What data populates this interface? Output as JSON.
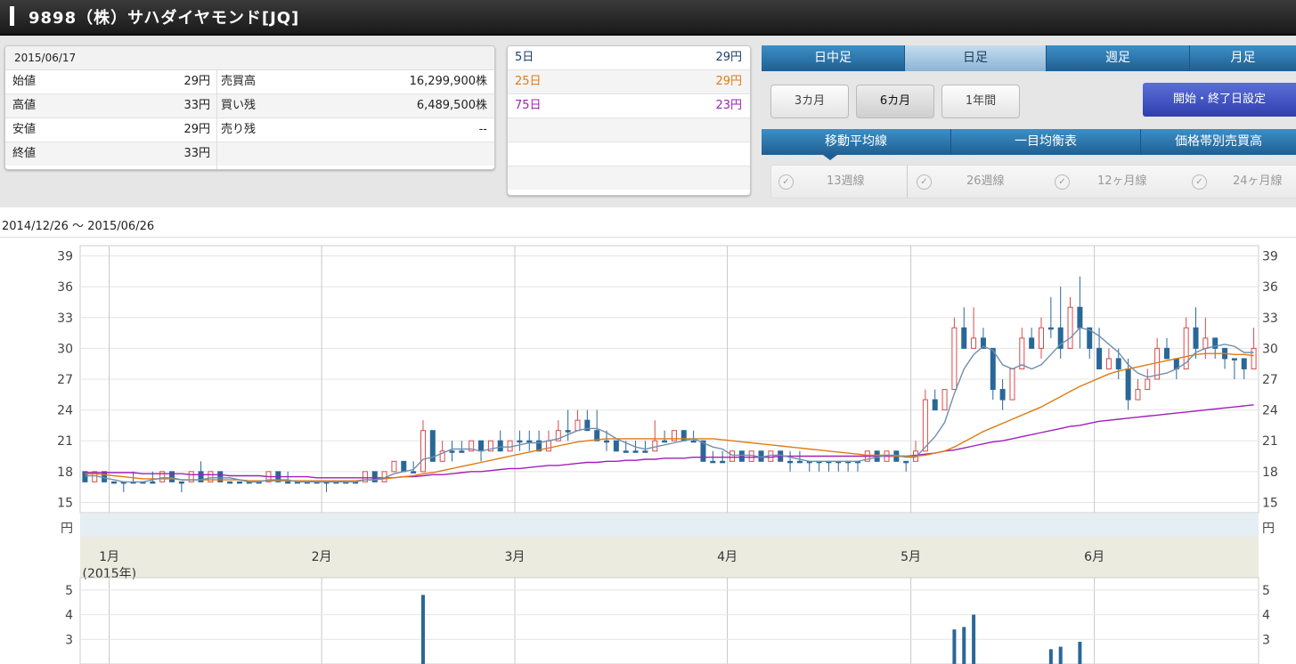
{
  "title": "9898（株）サハダイヤモンド[JQ]",
  "quote": {
    "date": "2015/06/17",
    "rows": [
      {
        "label": "始値",
        "value": "29円",
        "label2": "売買高",
        "value2": "16,299,900株"
      },
      {
        "label": "高値",
        "value": "33円",
        "label2": "買い残",
        "value2": "6,489,500株"
      },
      {
        "label": "安値",
        "value": "29円",
        "label2": "売り残",
        "value2": "--"
      },
      {
        "label": "終値",
        "value": "33円",
        "label2": "",
        "value2": ""
      }
    ]
  },
  "ma": [
    {
      "label": "5日",
      "value": "29円",
      "color": "#1c3f6e"
    },
    {
      "label": "25日",
      "value": "29円",
      "color": "#e07b12"
    },
    {
      "label": "75日",
      "value": "23円",
      "color": "#a020b8"
    }
  ],
  "tabs": [
    "日中足",
    "日足",
    "週足",
    "月足"
  ],
  "active_tab": "日足",
  "periods": [
    "3カ月",
    "6カ月",
    "1年間"
  ],
  "active_period": "6カ月",
  "range_button": "開始・終了日設定",
  "indicator_tabs": [
    "移動平均線",
    "一目均衡表",
    "価格帯別売買高"
  ],
  "checks": [
    "13週線",
    "26週線",
    "12ヶ月線",
    "24ヶ月線"
  ],
  "date_range": "2014/12/26 ～ 2015/06/26",
  "chart_data": {
    "type": "candlestick",
    "price_axis": {
      "ticks": [
        39,
        36,
        33,
        30,
        27,
        24,
        21,
        18,
        15
      ],
      "unit": "円",
      "ylim": [
        14,
        40
      ]
    },
    "months": [
      {
        "label": "1月",
        "sub": "(2015年)",
        "day": 3
      },
      {
        "label": "2月",
        "day": 25
      },
      {
        "label": "3月",
        "day": 45
      },
      {
        "label": "4月",
        "day": 67
      },
      {
        "label": "5月",
        "day": 86
      },
      {
        "label": "6月",
        "day": 105
      }
    ],
    "volume_axis": {
      "ticks": [
        5,
        4,
        3
      ]
    },
    "candles": [
      [
        18,
        18,
        17,
        17
      ],
      [
        17,
        18,
        17,
        18
      ],
      [
        18,
        18,
        17,
        17
      ],
      [
        17,
        17,
        17,
        17
      ],
      [
        17,
        17,
        16,
        17
      ],
      [
        17,
        18,
        17,
        17
      ],
      [
        17,
        17,
        17,
        17
      ],
      [
        17,
        18,
        17,
        17
      ],
      [
        17,
        18,
        17,
        18
      ],
      [
        18,
        18,
        17,
        17
      ],
      [
        17,
        17,
        16,
        17
      ],
      [
        17,
        18,
        17,
        18
      ],
      [
        18,
        19,
        17,
        17
      ],
      [
        17,
        18,
        17,
        18
      ],
      [
        18,
        18,
        17,
        17
      ],
      [
        17,
        17,
        17,
        17
      ],
      [
        17,
        17,
        17,
        17
      ],
      [
        17,
        17,
        17,
        17
      ],
      [
        17,
        17,
        17,
        17
      ],
      [
        17,
        17,
        17,
        18
      ],
      [
        18,
        18,
        17,
        17
      ],
      [
        17,
        18,
        17,
        17
      ],
      [
        17,
        17,
        17,
        17
      ],
      [
        17,
        17,
        17,
        17
      ],
      [
        17,
        17,
        17,
        17
      ],
      [
        17,
        17,
        16,
        17
      ],
      [
        17,
        17,
        17,
        17
      ],
      [
        17,
        17,
        17,
        17
      ],
      [
        17,
        17,
        17,
        17
      ],
      [
        17,
        18,
        17,
        18
      ],
      [
        18,
        18,
        17,
        17
      ],
      [
        17,
        18,
        17,
        18
      ],
      [
        18,
        19,
        18,
        19
      ],
      [
        19,
        19,
        18,
        18
      ],
      [
        18,
        19,
        18,
        18
      ],
      [
        18,
        23,
        18,
        22
      ],
      [
        22,
        22,
        19,
        19
      ],
      [
        19,
        21,
        19,
        20
      ],
      [
        20,
        21,
        19,
        20
      ],
      [
        20,
        21,
        20,
        20
      ],
      [
        20,
        21,
        20,
        21
      ],
      [
        21,
        21,
        19,
        20
      ],
      [
        20,
        21,
        20,
        21
      ],
      [
        21,
        22,
        20,
        20
      ],
      [
        20,
        21,
        20,
        21
      ],
      [
        21,
        22,
        20,
        21
      ],
      [
        21,
        22,
        20,
        21
      ],
      [
        21,
        22,
        20,
        20
      ],
      [
        20,
        22,
        20,
        21
      ],
      [
        21,
        23,
        21,
        22
      ],
      [
        22,
        24,
        21,
        22
      ],
      [
        22,
        24,
        22,
        23
      ],
      [
        23,
        24,
        22,
        22
      ],
      [
        22,
        24,
        21,
        21
      ],
      [
        21,
        22,
        20,
        21
      ],
      [
        21,
        21,
        20,
        20
      ],
      [
        20,
        21,
        20,
        20
      ],
      [
        20,
        21,
        20,
        20
      ],
      [
        20,
        21,
        20,
        20
      ],
      [
        20,
        23,
        20,
        21
      ],
      [
        21,
        22,
        21,
        21
      ],
      [
        21,
        22,
        21,
        22
      ],
      [
        22,
        22,
        21,
        21
      ],
      [
        21,
        22,
        21,
        21
      ],
      [
        21,
        21,
        19,
        19
      ],
      [
        19,
        20,
        19,
        19
      ],
      [
        19,
        20,
        19,
        19
      ],
      [
        19,
        20,
        19,
        20
      ],
      [
        20,
        20,
        19,
        19
      ],
      [
        19,
        20,
        19,
        20
      ],
      [
        20,
        20,
        19,
        19
      ],
      [
        19,
        20,
        19,
        20
      ],
      [
        20,
        20,
        19,
        19
      ],
      [
        19,
        20,
        18,
        19
      ],
      [
        19,
        20,
        19,
        19
      ],
      [
        19,
        19,
        18,
        19
      ],
      [
        19,
        19,
        18,
        19
      ],
      [
        19,
        19,
        18,
        19
      ],
      [
        19,
        19,
        18,
        19
      ],
      [
        19,
        19,
        18,
        19
      ],
      [
        19,
        19,
        18,
        19
      ],
      [
        19,
        20,
        19,
        20
      ],
      [
        20,
        20,
        19,
        19
      ],
      [
        19,
        20,
        19,
        20
      ],
      [
        20,
        20,
        19,
        19
      ],
      [
        19,
        19,
        18,
        19
      ],
      [
        19,
        21,
        19,
        20
      ],
      [
        20,
        26,
        20,
        25
      ],
      [
        25,
        26,
        24,
        24
      ],
      [
        24,
        26,
        24,
        26
      ],
      [
        26,
        33,
        26,
        32
      ],
      [
        32,
        34,
        30,
        30
      ],
      [
        30,
        34,
        30,
        31
      ],
      [
        31,
        32,
        30,
        30
      ],
      [
        30,
        29,
        25,
        26
      ],
      [
        26,
        27,
        24,
        25
      ],
      [
        25,
        28,
        25,
        28
      ],
      [
        28,
        32,
        28,
        31
      ],
      [
        31,
        32,
        30,
        30
      ],
      [
        30,
        33,
        29,
        32
      ],
      [
        32,
        35,
        31,
        32
      ],
      [
        32,
        36,
        29,
        30
      ],
      [
        30,
        35,
        30,
        34
      ],
      [
        34,
        37,
        30,
        32
      ],
      [
        32,
        32,
        29,
        30
      ],
      [
        30,
        32,
        28,
        28
      ],
      [
        28,
        30,
        28,
        29
      ],
      [
        29,
        30,
        27,
        28
      ],
      [
        28,
        29,
        24,
        25
      ],
      [
        25,
        27,
        25,
        26
      ],
      [
        26,
        28,
        26,
        27
      ],
      [
        27,
        31,
        27,
        30
      ],
      [
        30,
        31,
        29,
        29
      ],
      [
        29,
        29,
        27,
        28
      ],
      [
        28,
        33,
        28,
        32
      ],
      [
        32,
        34,
        29,
        30
      ],
      [
        30,
        33,
        29,
        31
      ],
      [
        31,
        31,
        29,
        30
      ],
      [
        30,
        30,
        28,
        29
      ],
      [
        29,
        29,
        27,
        29
      ],
      [
        29,
        29,
        27,
        28
      ],
      [
        28,
        32,
        28,
        30
      ]
    ],
    "ma5": [
      17.6,
      17.6,
      17.4,
      17.2,
      17,
      17,
      17,
      17.2,
      17.4,
      17.4,
      17.2,
      17.2,
      17.2,
      17.4,
      17.4,
      17.4,
      17.2,
      17,
      17,
      17.2,
      17.2,
      17.2,
      17,
      17,
      17,
      17,
      17,
      17,
      17,
      17.2,
      17.2,
      17.4,
      17.8,
      18,
      18.2,
      19.2,
      19.4,
      19.8,
      20.2,
      20.2,
      20.2,
      20,
      20.2,
      20.4,
      20.4,
      20.6,
      20.8,
      20.8,
      21,
      21.2,
      21.6,
      22,
      22.2,
      22.2,
      21.8,
      21.2,
      20.8,
      20.4,
      20.2,
      20.4,
      20.6,
      20.8,
      21,
      21.2,
      20.8,
      20.4,
      20.2,
      19.6,
      19.6,
      19.6,
      19.4,
      19.6,
      19.6,
      19.4,
      19.2,
      19,
      19,
      19,
      19,
      19,
      19,
      19.2,
      19.4,
      19.6,
      19.6,
      19.4,
      19.4,
      20.4,
      21.4,
      22.8,
      25.6,
      28,
      29.4,
      30.2,
      29.8,
      28.4,
      28,
      28.4,
      28,
      28.4,
      29.4,
      30.4,
      31,
      32,
      31.8,
      31.2,
      30.4,
      29.6,
      28.4,
      27.6,
      27.2,
      27.4,
      27.6,
      28,
      28.6,
      29.6,
      30,
      30.2,
      30.4,
      30.2,
      29.6,
      29.6
    ],
    "ma25": [
      17.8,
      17.8,
      17.7,
      17.6,
      17.5,
      17.4,
      17.3,
      17.3,
      17.3,
      17.3,
      17.2,
      17.2,
      17.2,
      17.2,
      17.2,
      17.2,
      17.2,
      17.1,
      17.1,
      17.1,
      17.1,
      17.1,
      17.1,
      17.1,
      17.1,
      17.1,
      17.1,
      17.1,
      17.1,
      17.2,
      17.2,
      17.3,
      17.4,
      17.5,
      17.6,
      17.8,
      17.9,
      18.1,
      18.3,
      18.5,
      18.7,
      18.9,
      19.1,
      19.3,
      19.5,
      19.7,
      19.9,
      20.1,
      20.3,
      20.5,
      20.7,
      20.9,
      21,
      21.1,
      21.2,
      21.2,
      21.2,
      21.2,
      21.2,
      21.2,
      21.2,
      21.2,
      21.2,
      21.2,
      21.2,
      21.2,
      21.1,
      21,
      20.9,
      20.8,
      20.7,
      20.6,
      20.5,
      20.4,
      20.3,
      20.2,
      20.1,
      20,
      19.9,
      19.8,
      19.7,
      19.6,
      19.6,
      19.6,
      19.5,
      19.5,
      19.5,
      19.6,
      19.8,
      20,
      20.4,
      20.9,
      21.4,
      21.9,
      22.3,
      22.7,
      23.1,
      23.5,
      23.9,
      24.3,
      24.8,
      25.3,
      25.8,
      26.3,
      26.7,
      27.1,
      27.5,
      27.8,
      28,
      28.2,
      28.4,
      28.6,
      28.8,
      29,
      29.2,
      29.4,
      29.5,
      29.5,
      29.5,
      29.4,
      29.4,
      29.3
    ],
    "ma75": [
      17.9,
      17.9,
      17.9,
      17.9,
      17.9,
      17.9,
      17.8,
      17.8,
      17.8,
      17.8,
      17.8,
      17.7,
      17.7,
      17.7,
      17.7,
      17.6,
      17.6,
      17.6,
      17.6,
      17.5,
      17.5,
      17.5,
      17.5,
      17.5,
      17.4,
      17.4,
      17.4,
      17.4,
      17.4,
      17.4,
      17.4,
      17.4,
      17.4,
      17.5,
      17.5,
      17.6,
      17.7,
      17.7,
      17.8,
      17.9,
      18,
      18,
      18.1,
      18.2,
      18.3,
      18.3,
      18.4,
      18.5,
      18.6,
      18.6,
      18.7,
      18.8,
      18.9,
      18.9,
      19,
      19,
      19.1,
      19.1,
      19.2,
      19.2,
      19.3,
      19.3,
      19.3,
      19.4,
      19.4,
      19.4,
      19.4,
      19.4,
      19.4,
      19.4,
      19.4,
      19.4,
      19.5,
      19.5,
      19.5,
      19.5,
      19.5,
      19.5,
      19.5,
      19.5,
      19.5,
      19.5,
      19.5,
      19.5,
      19.5,
      19.5,
      19.6,
      19.7,
      19.8,
      20,
      20.1,
      20.3,
      20.5,
      20.7,
      20.9,
      21,
      21.2,
      21.4,
      21.6,
      21.8,
      22,
      22.2,
      22.4,
      22.5,
      22.7,
      22.9,
      23,
      23.1,
      23.2,
      23.3,
      23.4,
      23.5,
      23.6,
      23.7,
      23.8,
      23.9,
      24,
      24.1,
      24.2,
      24.3,
      24.4,
      24.5
    ],
    "volume": [
      {
        "day": 35,
        "value": 4.8
      },
      {
        "day": 90,
        "value": 3.4
      },
      {
        "day": 91,
        "value": 3.5
      },
      {
        "day": 92,
        "value": 4
      },
      {
        "day": 100,
        "value": 2.6
      },
      {
        "day": 101,
        "value": 2.7
      },
      {
        "day": 103,
        "value": 2.9
      }
    ],
    "volume_ylim": [
      2,
      5.5
    ]
  }
}
